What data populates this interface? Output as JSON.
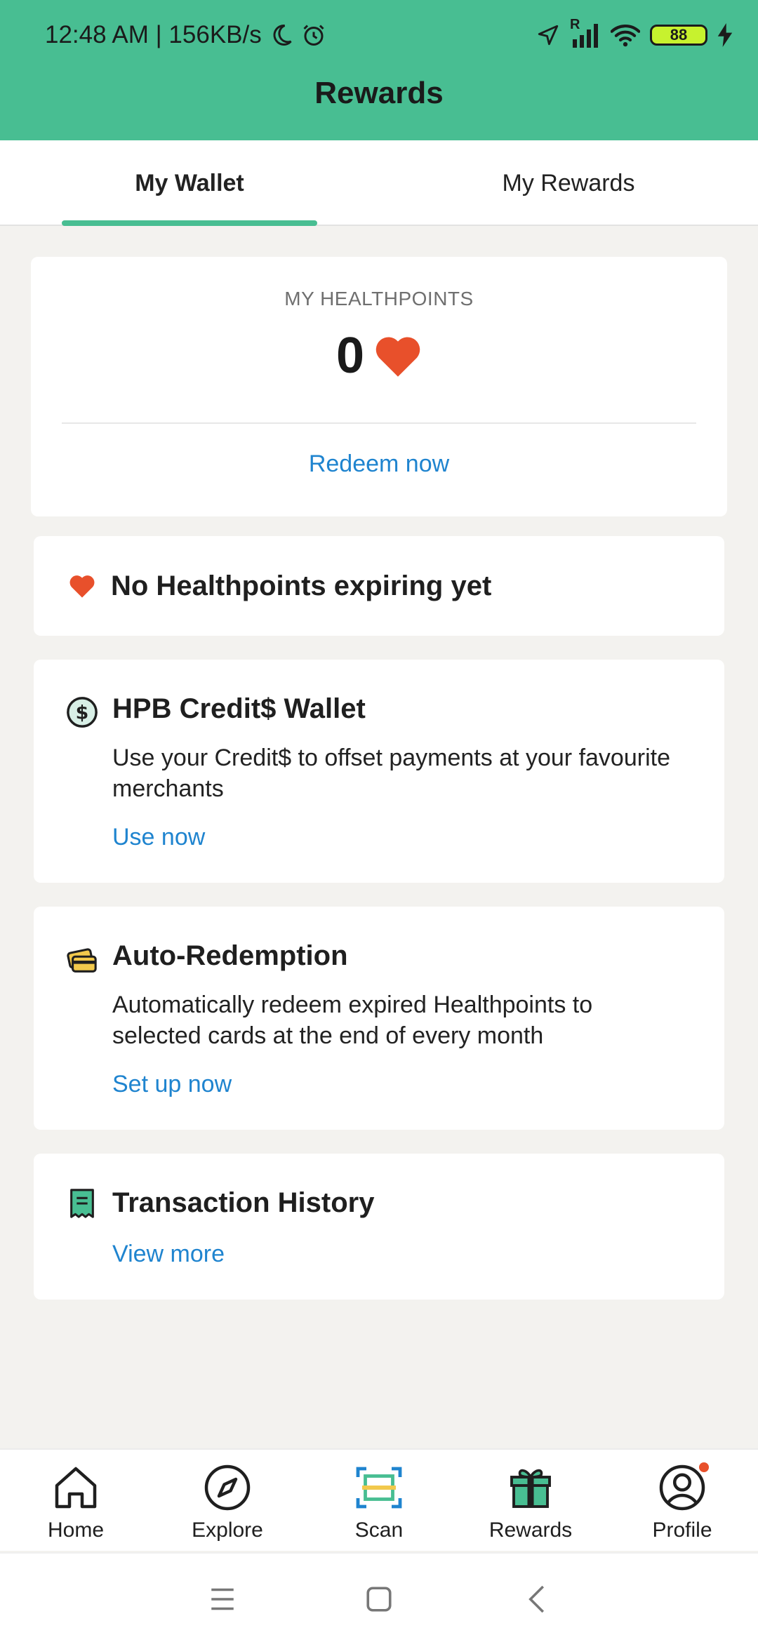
{
  "status_bar": {
    "time_speed": "12:48 AM | 156KB/s",
    "signal_label": "R",
    "battery": "88"
  },
  "header": {
    "title": "Rewards"
  },
  "tabs": [
    {
      "label": "My Wallet",
      "active": true
    },
    {
      "label": "My Rewards",
      "active": false
    }
  ],
  "healthpoints": {
    "label": "MY HEALTHPOINTS",
    "value": "0",
    "action": "Redeem now"
  },
  "expiry": {
    "text": "No Healthpoints expiring yet"
  },
  "credit_wallet": {
    "title": "HPB Credit$ Wallet",
    "description": "Use your Credit$ to offset payments at your favourite merchants",
    "action": "Use now"
  },
  "auto_redemption": {
    "title": "Auto-Redemption",
    "description": "Automatically redeem expired Healthpoints to selected cards at the end of every month",
    "action": "Set up now"
  },
  "transaction_history": {
    "title": "Transaction History",
    "action": "View more"
  },
  "bottom_nav": [
    {
      "label": "Home",
      "icon": "home-icon"
    },
    {
      "label": "Explore",
      "icon": "compass-icon"
    },
    {
      "label": "Scan",
      "icon": "scan-icon"
    },
    {
      "label": "Rewards",
      "icon": "gift-icon"
    },
    {
      "label": "Profile",
      "icon": "profile-icon"
    }
  ],
  "colors": {
    "brand_green": "#48be92",
    "link_blue": "#1f84cf",
    "heart_orange": "#e8502b",
    "background": "#f3f2ef"
  }
}
